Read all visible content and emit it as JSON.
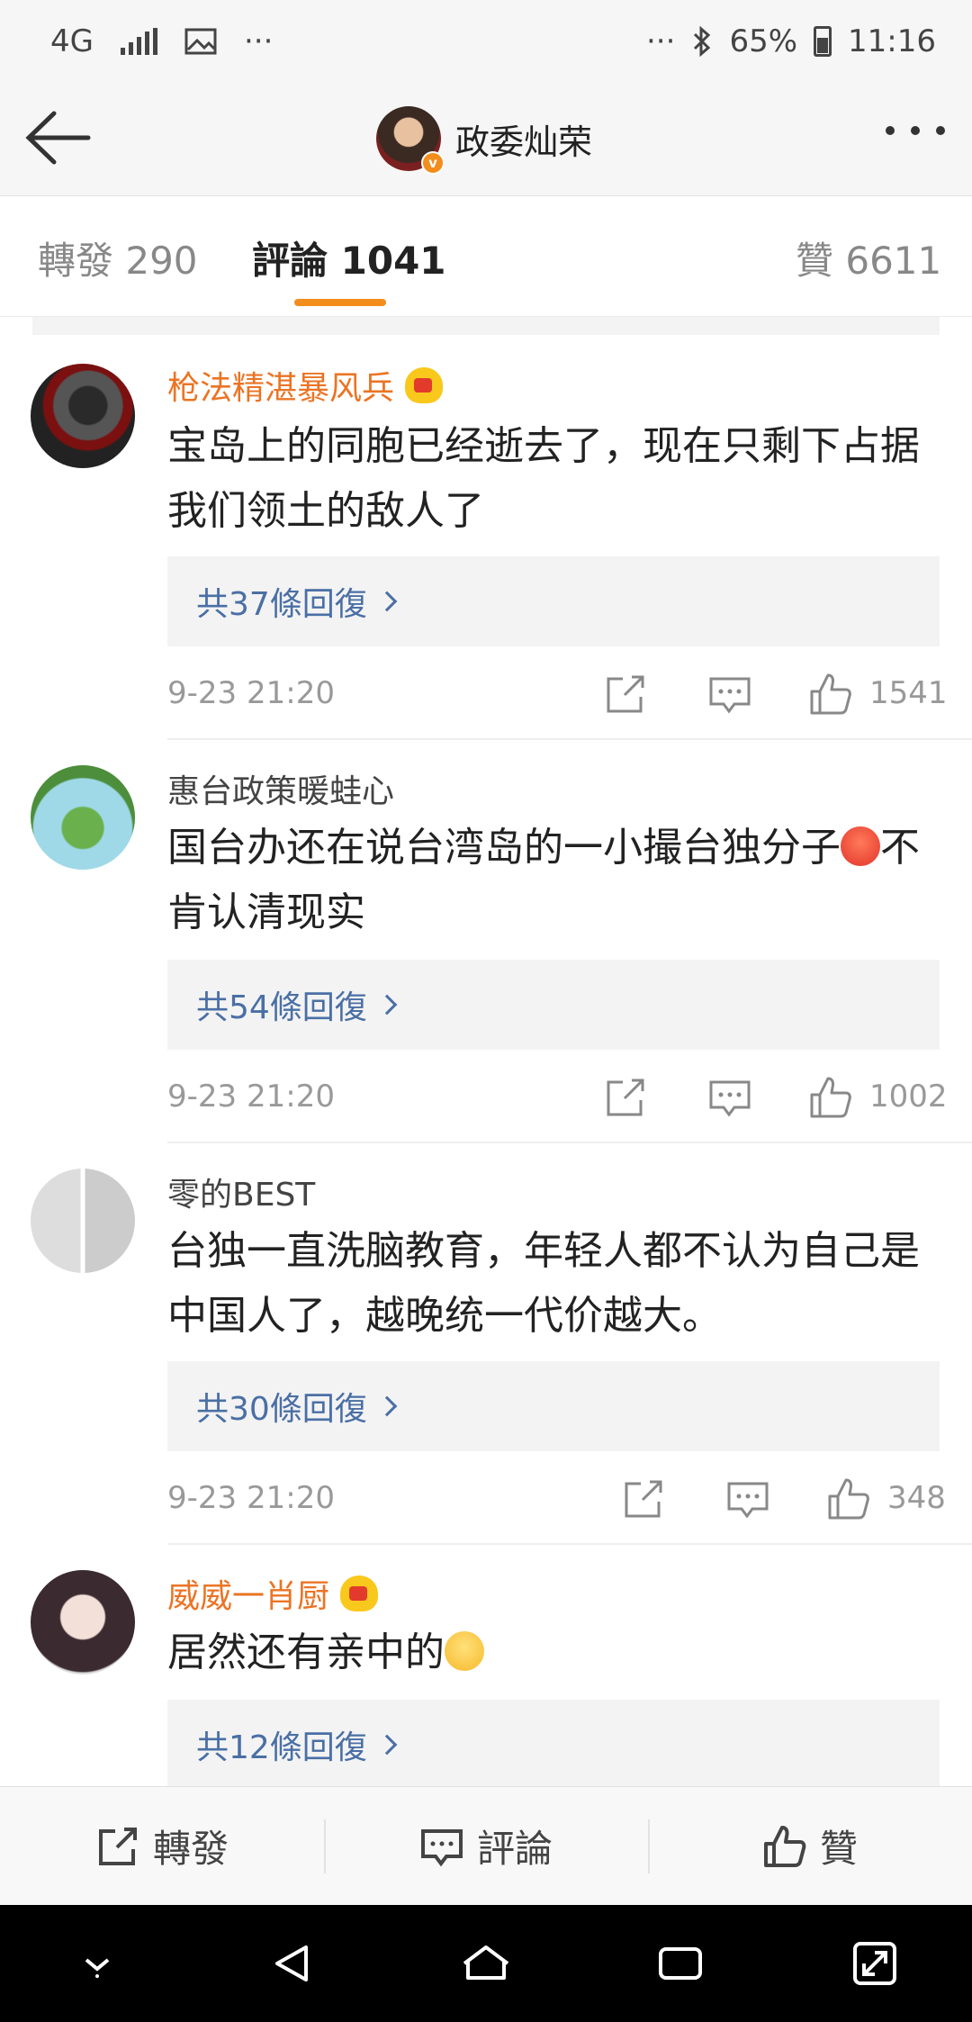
{
  "status_bar": {
    "network": "4G",
    "more": "···",
    "battery": "65%",
    "time": "11:16"
  },
  "nav": {
    "title": "政委灿荣"
  },
  "tabs": [
    {
      "label": "轉發 290"
    },
    {
      "label": "評論 1041"
    },
    {
      "label": "贊 6611"
    }
  ],
  "comments": [
    {
      "user": "枪法精湛暴风兵",
      "text": "宝岛上的同胞已经逝去了，现在只剩下占据我们领土的敌人了",
      "replies": "共37條回復",
      "time": "9-23 21:20",
      "likes": "1541"
    },
    {
      "user": "惠台政策暖蛙心",
      "text_a": "国台办还在说台湾岛的一小撮台独分子",
      "text_b": "不肯认清现实",
      "replies": "共54條回復",
      "time": "9-23 21:20",
      "likes": "1002"
    },
    {
      "user": "零的BEST",
      "text": "台独一直洗脑教育，年轻人都不认为自己是中国人了，越晚统一代价越大。",
      "replies": "共30條回復",
      "time": "9-23 21:20",
      "likes": "348"
    },
    {
      "user": "威威一肖厨",
      "text": "居然还有亲中的",
      "replies": "共12條回復"
    }
  ],
  "bottom_bar": {
    "repost": "轉發",
    "comment": "評論",
    "like": "贊"
  },
  "colors": {
    "accent": "#f38d1c",
    "vip_name": "#eb7424",
    "reply_link": "#4a6fa5"
  }
}
